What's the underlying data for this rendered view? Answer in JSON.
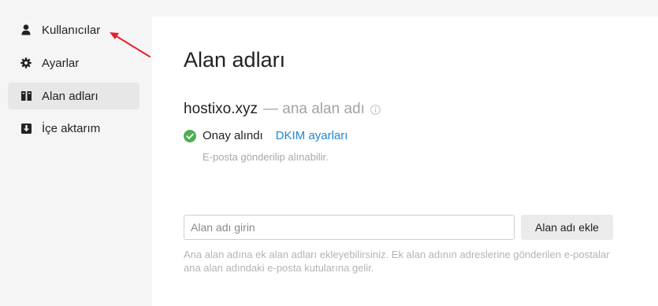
{
  "sidebar": {
    "items": [
      {
        "label": "Kullanıcılar",
        "icon": "user-icon",
        "active": false
      },
      {
        "label": "Ayarlar",
        "icon": "gear-icon",
        "active": false
      },
      {
        "label": "Alan adları",
        "icon": "domains-icon",
        "active": true
      },
      {
        "label": "İçe aktarım",
        "icon": "import-icon",
        "active": false
      }
    ]
  },
  "main": {
    "title": "Alan adları",
    "domain": {
      "name": "hostixo.xyz",
      "suffix": "— ana alan adı",
      "status_label": "Onay alındı",
      "dkim_link": "DKIM ayarları",
      "status_description": "E-posta gönderilip alınabilir."
    },
    "add_form": {
      "input_placeholder": "Alan adı girin",
      "input_value": "",
      "button_label": "Alan adı ekle",
      "hint": "Ana alan adına ek alan adları ekleyebilirsiniz. Ek alan adının adreslerine gönderilen e-postalar ana alan adındaki e-posta kutularına gelir."
    }
  },
  "colors": {
    "link": "#1e88d6",
    "success": "#4caf50",
    "annotation": "#e8202a",
    "active_nav": "#e7e7e7"
  }
}
